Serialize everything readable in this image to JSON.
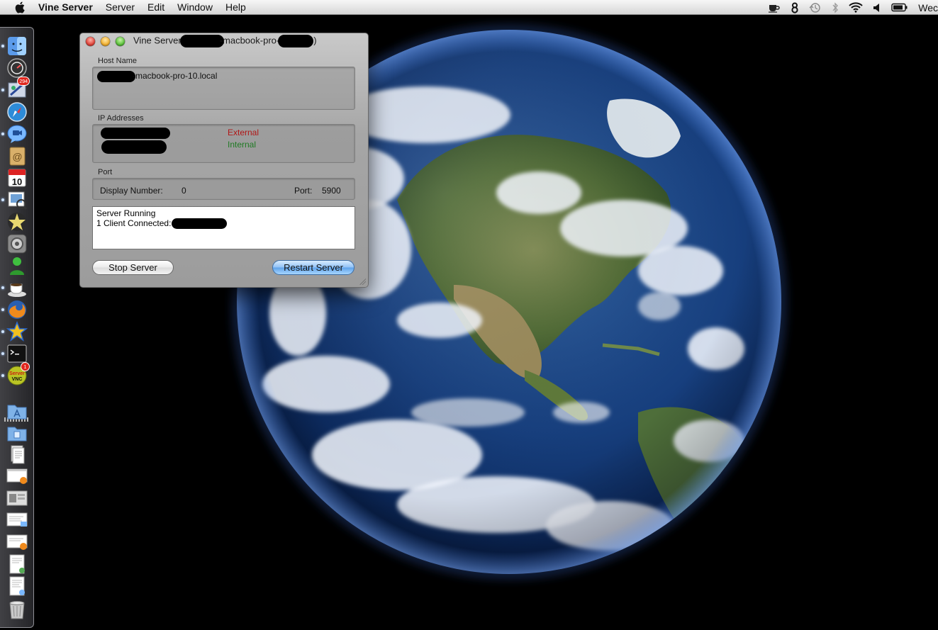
{
  "menubar": {
    "app_name": "Vine Server",
    "menus": [
      "Server",
      "Edit",
      "Window",
      "Help"
    ],
    "status_icons": [
      "coffee-cup-icon",
      "numeral-8-icon",
      "time-machine-icon",
      "bluetooth-icon",
      "wifi-icon",
      "volume-icon",
      "battery-icon"
    ],
    "clock": "Wec"
  },
  "window": {
    "title_prefix": "Vine Server",
    "title_middle": "-macbook-pro-",
    "title_suffix": ")",
    "host_name_label": "Host Name",
    "host_name_value": "-macbook-pro-10.local",
    "ip_label": "IP Addresses",
    "ip_external_label": "External",
    "ip_internal_label": "Internal",
    "port_label": "Port",
    "display_number_label": "Display Number:",
    "display_number_value": "0",
    "port_field_label": "Port:",
    "port_value": "5900",
    "status_line1": "Server Running",
    "status_line2": "1 Client Connected:",
    "stop_button": "Stop Server",
    "restart_button": "Restart Server"
  },
  "dock": {
    "badges": {
      "mail": "294",
      "vine": "1"
    },
    "calendar_day": "10",
    "vine_text": "Server\nVNC"
  },
  "colors": {
    "external": "#b01818",
    "internal": "#1f7a23",
    "restart_button": "#5ea2ea"
  }
}
